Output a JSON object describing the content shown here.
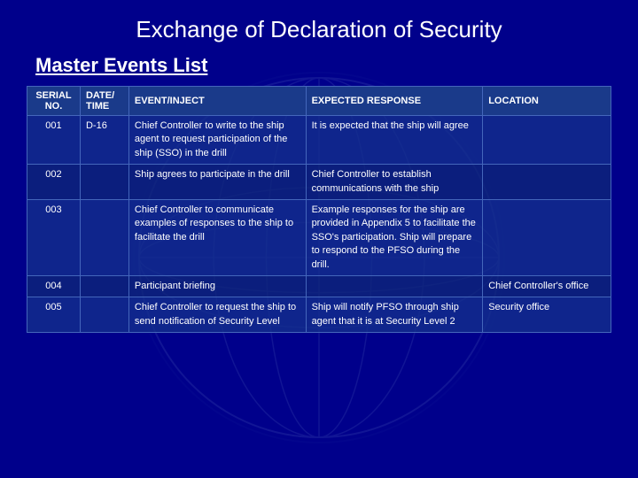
{
  "page": {
    "title": "Exchange of Declaration of Security",
    "section_title": "Master Events List"
  },
  "table": {
    "headers": {
      "serial": "SERIAL NO.",
      "date": "DATE/ TIME",
      "event": "EVENT/INJECT",
      "response": "EXPECTED RESPONSE",
      "location": "LOCATION"
    },
    "rows": [
      {
        "serial": "001",
        "date": "D-16",
        "event": "Chief Controller to write to the ship agent to request participation of the ship (SSO) in the drill",
        "response": "It is expected that the ship will agree",
        "location": ""
      },
      {
        "serial": "002",
        "date": "",
        "event": "Ship agrees to participate in the drill",
        "response": "Chief Controller to establish communications with the ship",
        "location": ""
      },
      {
        "serial": "003",
        "date": "",
        "event": "Chief Controller to communicate examples of responses to the ship to facilitate the drill",
        "response": "Example responses for the ship are provided in Appendix 5 to facilitate the SSO's participation. Ship will prepare to respond to the PFSO during the drill.",
        "location": ""
      },
      {
        "serial": "004",
        "date": "",
        "event": "Participant briefing",
        "response": "",
        "location": "Chief Controller's office"
      },
      {
        "serial": "005",
        "date": "",
        "event": "Chief Controller to request the ship to send notification of Security Level",
        "response": "Ship will notify PFSO through ship agent that it is at Security Level 2",
        "location": "Security office"
      }
    ]
  }
}
